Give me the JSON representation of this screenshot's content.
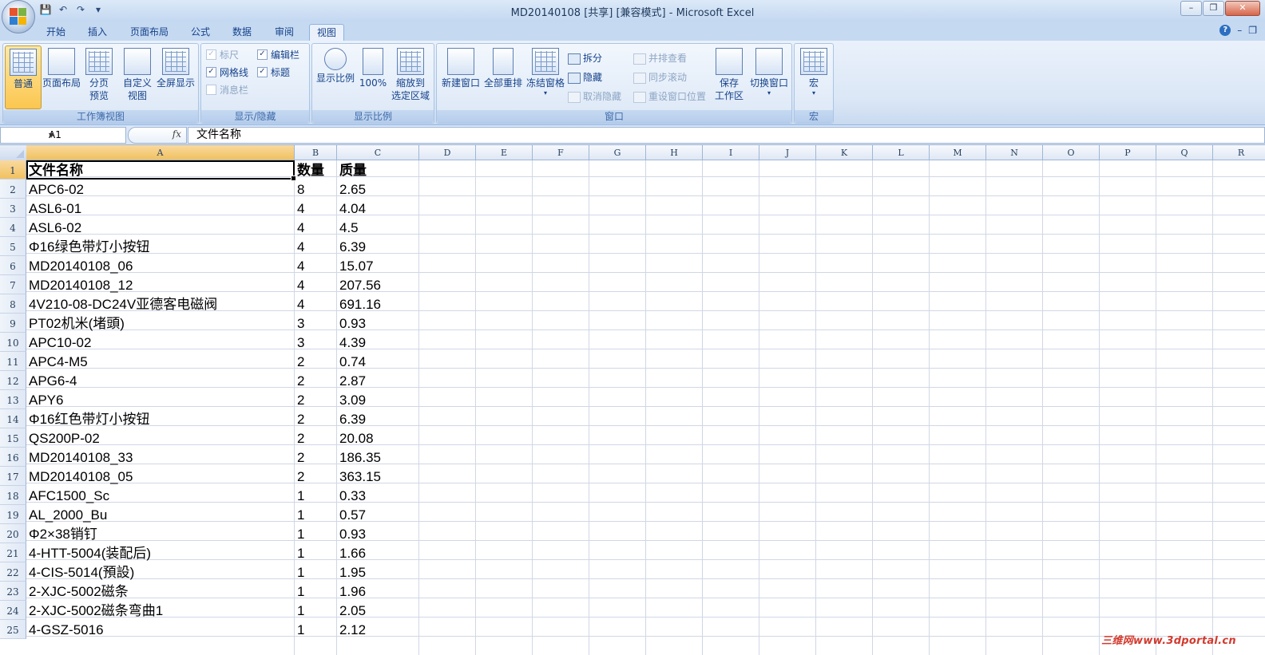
{
  "window": {
    "title": "MD20140108  [共享]  [兼容模式] - Microsoft Excel"
  },
  "qat": {
    "save": "💾",
    "undo": "↶",
    "redo": "↷",
    "more": "▾"
  },
  "tabs": [
    {
      "label": "开始",
      "active": false
    },
    {
      "label": "插入",
      "active": false
    },
    {
      "label": "页面布局",
      "active": false
    },
    {
      "label": "公式",
      "active": false
    },
    {
      "label": "数据",
      "active": false
    },
    {
      "label": "审阅",
      "active": false
    },
    {
      "label": "视图",
      "active": true
    }
  ],
  "ribbon": {
    "workbook_views": {
      "label": "工作簿视图",
      "normal": "普通",
      "page_layout": "页面布局",
      "page_break_1": "分页",
      "page_break_2": "预览",
      "custom_1": "自定义",
      "custom_2": "视图",
      "fullscreen": "全屏显示"
    },
    "show_hide": {
      "label": "显示/隐藏",
      "ruler": "标尺",
      "gridlines": "网格线",
      "message_bar": "消息栏",
      "formula_bar": "编辑栏",
      "headings": "标题"
    },
    "zoom": {
      "label": "显示比例",
      "zoom": "显示比例",
      "hundred": "100%",
      "zoom_sel_1": "缩放到",
      "zoom_sel_2": "选定区域"
    },
    "window": {
      "label": "窗口",
      "new_window": "新建窗口",
      "arrange_all": "全部重排",
      "freeze": "冻结窗格",
      "split": "拆分",
      "hide": "隐藏",
      "unhide": "取消隐藏",
      "side_by_side": "并排查看",
      "sync_scroll": "同步滚动",
      "reset_pos": "重设窗口位置",
      "save_ws_1": "保存",
      "save_ws_2": "工作区",
      "switch": "切换窗口"
    },
    "macros": {
      "label": "宏",
      "macros": "宏"
    }
  },
  "formula_bar": {
    "name_box": "A1",
    "fx": "fx",
    "content": "文件名称"
  },
  "columns": [
    "A",
    "B",
    "C",
    "D",
    "E",
    "F",
    "G",
    "H",
    "I",
    "J",
    "K",
    "L",
    "M",
    "N",
    "O",
    "P",
    "Q",
    "R"
  ],
  "row_numbers": [
    "1",
    "2",
    "3",
    "4",
    "5",
    "6",
    "7",
    "8",
    "9",
    "10",
    "11",
    "12",
    "13",
    "14",
    "15",
    "16",
    "17",
    "18",
    "19",
    "20",
    "21",
    "22",
    "23",
    "24",
    "25"
  ],
  "rows": [
    [
      "文件名称",
      "数量",
      "质量"
    ],
    [
      "APC6-02",
      "8",
      "2.65"
    ],
    [
      "ASL6-01",
      "4",
      "4.04"
    ],
    [
      "ASL6-02",
      "4",
      "4.5"
    ],
    [
      "Φ16绿色带灯小按钮",
      "4",
      "6.39"
    ],
    [
      "MD20140108_06",
      "4",
      "15.07"
    ],
    [
      "MD20140108_12",
      "4",
      "207.56"
    ],
    [
      "4V210-08-DC24V亚德客电磁阀",
      "4",
      "691.16"
    ],
    [
      "PT02机米(堵頭)",
      "3",
      "0.93"
    ],
    [
      "APC10-02",
      "3",
      "4.39"
    ],
    [
      "APC4-M5",
      "2",
      "0.74"
    ],
    [
      "APG6-4",
      "2",
      "2.87"
    ],
    [
      "APY6",
      "2",
      "3.09"
    ],
    [
      "Φ16红色带灯小按钮",
      "2",
      "6.39"
    ],
    [
      "QS200P-02",
      "2",
      "20.08"
    ],
    [
      "MD20140108_33",
      "2",
      "186.35"
    ],
    [
      "MD20140108_05",
      "2",
      "363.15"
    ],
    [
      "AFC1500_Sc",
      "1",
      "0.33"
    ],
    [
      "AL_2000_Bu",
      "1",
      "0.57"
    ],
    [
      "Φ2×38销钉",
      "1",
      "0.93"
    ],
    [
      "4-HTT-5004(装配后)",
      "1",
      "1.66"
    ],
    [
      "4-CIS-5014(預設)",
      "1",
      "1.95"
    ],
    [
      "2-XJC-5002磁条",
      "1",
      "1.96"
    ],
    [
      "2-XJC-5002磁条弯曲1",
      "1",
      "2.05"
    ],
    [
      "4-GSZ-5016",
      "1",
      "2.12"
    ]
  ],
  "watermark": "三维网www.3dportal.cn",
  "colors": {
    "ribbon_bg": "#dbe7f6",
    "accent": "#15428b",
    "active_btn": "#fbc64e"
  }
}
